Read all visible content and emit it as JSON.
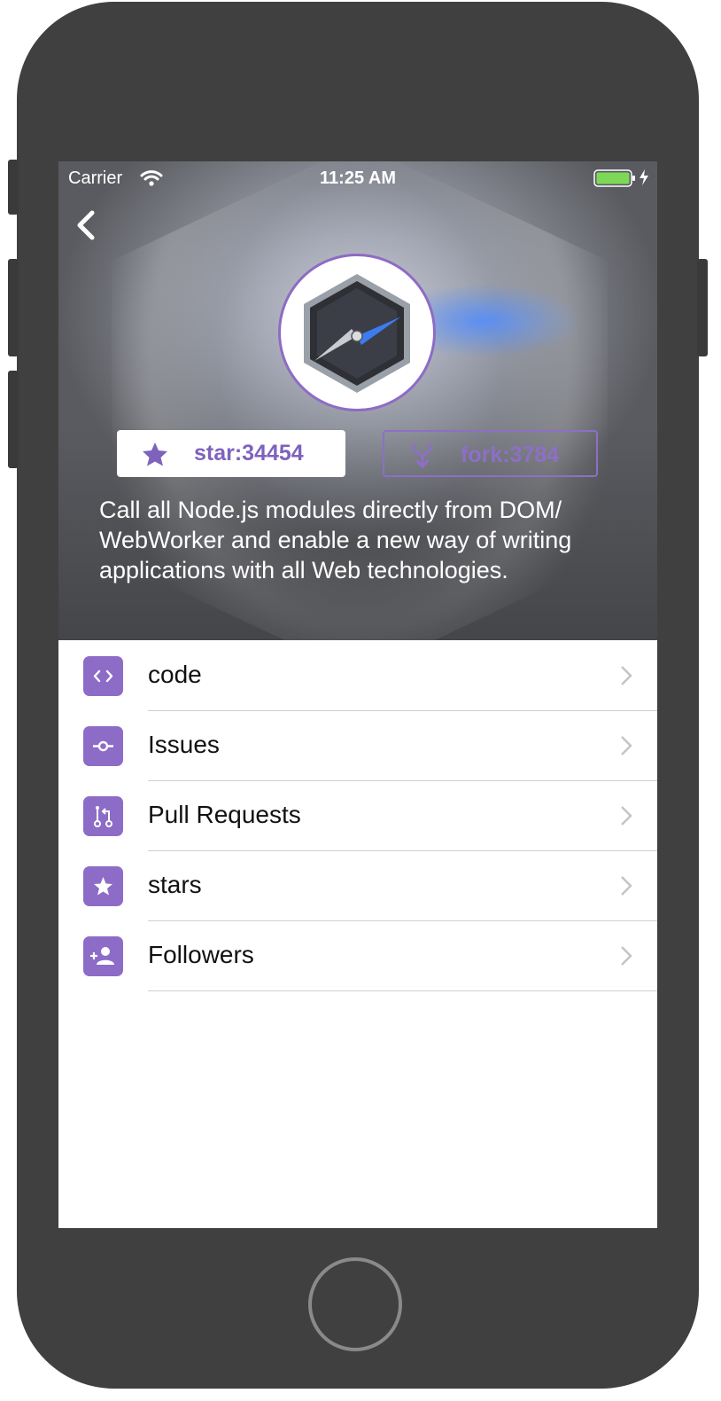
{
  "status_bar": {
    "carrier": "Carrier",
    "time": "11:25 AM"
  },
  "repo": {
    "star_label": "star:34454",
    "fork_label": "fork:3784",
    "description": "Call all Node.js modules directly from DOM/ WebWorker and enable a new way of writing applications with all Web technologies."
  },
  "menu": [
    {
      "label": "code",
      "icon": "code-icon"
    },
    {
      "label": "Issues",
      "icon": "issue-icon"
    },
    {
      "label": "Pull Requests",
      "icon": "pull-request-icon"
    },
    {
      "label": "stars",
      "icon": "star-icon"
    },
    {
      "label": "Followers",
      "icon": "add-person-icon"
    }
  ],
  "colors": {
    "accent": "#8d6cc8",
    "battery": "#7ed858"
  }
}
